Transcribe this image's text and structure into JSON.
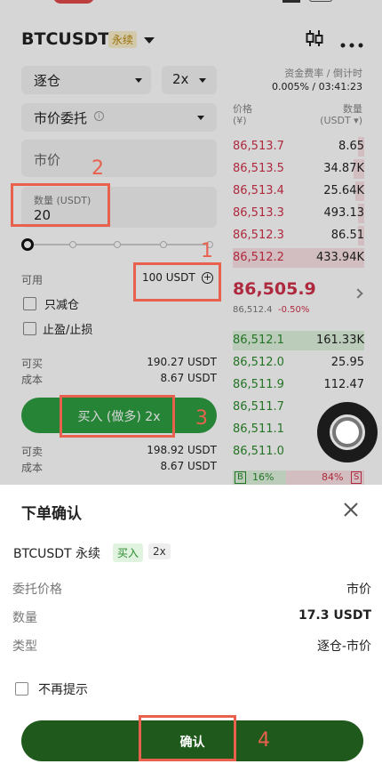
{
  "header": {
    "symbol": "BTCUSDT",
    "contract_badge": "永续"
  },
  "order_form": {
    "margin_mode": "逐仓",
    "leverage": "2x",
    "order_type": "市价委托",
    "price_placeholder": "市价",
    "quantity_label": "数量 (USDT)",
    "quantity_value": "20",
    "available_label": "可用",
    "available_value": "100 USDT",
    "reduce_only_label": "只减仓",
    "tp_sl_label": "止盈/止损",
    "buy": {
      "can_buy_label": "可买",
      "can_buy_value": "190.27 USDT",
      "cost_label": "成本",
      "cost_value": "8.67 USDT",
      "button_label": "买入 (做多) 2x"
    },
    "sell": {
      "can_sell_label": "可卖",
      "can_sell_value": "198.92 USDT",
      "cost_label": "成本",
      "cost_value": "8.67 USDT"
    }
  },
  "funding": {
    "label": "资金费率 / 倒计时",
    "value": "0.005% / 03:41:23"
  },
  "orderbook": {
    "price_header": "价格",
    "price_unit": "(¥)",
    "qty_header": "数量",
    "qty_unit": "(USDT ▾)",
    "asks": [
      {
        "price": "86,513.7",
        "qty": "8.65",
        "depth": 0.05
      },
      {
        "price": "86,513.5",
        "qty": "34.87K",
        "depth": 0.08
      },
      {
        "price": "86,513.4",
        "qty": "25.64K",
        "depth": 0.07
      },
      {
        "price": "86,513.3",
        "qty": "493.13",
        "depth": 0.05
      },
      {
        "price": "86,512.3",
        "qty": "86.51",
        "depth": 0.05
      },
      {
        "price": "86,512.2",
        "qty": "433.94K",
        "depth": 1.0
      }
    ],
    "last_price": "86,505.9",
    "mark_price": "86,512.4",
    "change": "-0.50%",
    "bids": [
      {
        "price": "86,512.1",
        "qty": "161.33K",
        "depth": 1.0
      },
      {
        "price": "86,512.0",
        "qty": "25.95",
        "depth": 0.0
      },
      {
        "price": "86,511.9",
        "qty": "112.47",
        "depth": 0.0
      },
      {
        "price": "86,511.7",
        "qty": "",
        "depth": 0.0
      },
      {
        "price": "86,511.1",
        "qty": "",
        "depth": 0.0
      },
      {
        "price": "86,511.0",
        "qty": "",
        "depth": 0.0
      }
    ],
    "ratio_buy_label": "B",
    "ratio_buy": "16%",
    "ratio_sell": "84%",
    "ratio_sell_label": "S"
  },
  "sheet": {
    "title": "下单确认",
    "symbol": "BTCUSDT 永续",
    "side_badge": "买入",
    "leverage_badge": "2x",
    "rows": [
      {
        "label": "委托价格",
        "value": "市价"
      },
      {
        "label": "数量",
        "value": "17.3 USDT"
      },
      {
        "label": "类型",
        "value": "逐仓-市价"
      }
    ],
    "no_remind_label": "不再提示",
    "confirm_label": "确认"
  },
  "annotations": [
    "1",
    "2",
    "3",
    "4"
  ],
  "colors": {
    "red": "#d0314a",
    "green": "#2c8b2e",
    "annotation": "#e8604e",
    "confirm_bg": "#1f5a1c",
    "buy_button": "#2e9e42"
  }
}
